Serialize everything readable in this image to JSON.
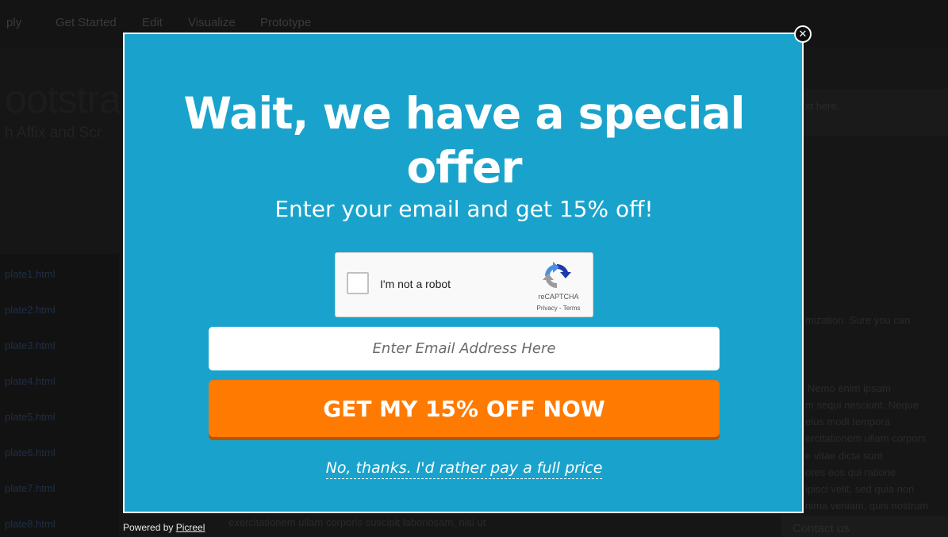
{
  "background": {
    "nav": [
      "ply",
      "Get Started",
      "Edit",
      "Visualize",
      "Prototype"
    ],
    "title": "ootstra",
    "subtitle": "h Affix and Scr",
    "links": [
      "plate1.html",
      "plate2.html",
      "plate3.html",
      "plate4.html",
      "plate5.html",
      "plate6.html",
      "plate7.html",
      "plate8.html"
    ],
    "right_text": [
      "xt here.",
      "mization. Sure you can",
      "Nemo enim ipsam",
      "m sequi nesciunt. Neque",
      "eius modi tempora",
      "ercitationem ullam corpors",
      "e vitae dicta sunt",
      "ores eos qui ratione",
      "ipisci velit, sed quia non",
      "nima veniam, quis nostrum"
    ],
    "bottom_text": "exercitationem ullam corporis suscipit laboriosam, nisi ut",
    "contact": "Contact us"
  },
  "popup": {
    "headline": "Wait, we have a special offer",
    "subheadline": "Enter your email and get 15% off!",
    "captcha": {
      "label": "I'm not a robot",
      "brand": "reCAPTCHA",
      "terms": "Privacy - Terms",
      "icon": "recaptcha-icon"
    },
    "email_placeholder": "Enter Email Address Here",
    "cta_label": "GET MY 15% OFF NOW",
    "decline_label": "No, thanks. I'd rather pay a full price",
    "close_icon": "close-icon",
    "colors": {
      "background": "#19a3cc",
      "cta": "#ff7a00",
      "text": "#ffffff"
    }
  },
  "footer": {
    "powered_prefix": "Powered by",
    "powered_link": "Picreel"
  }
}
